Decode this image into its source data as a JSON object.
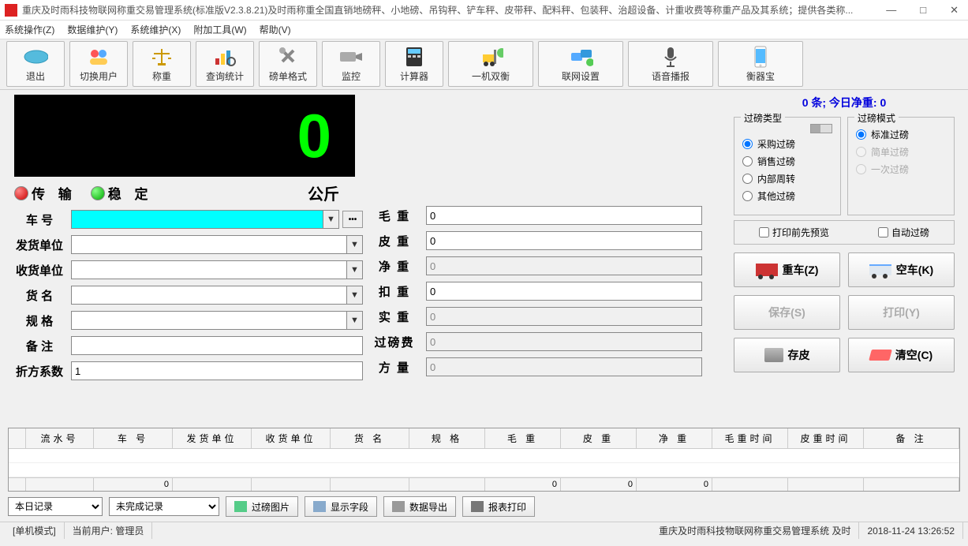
{
  "window": {
    "title": "重庆及时雨科技物联网称重交易管理系统(标准版V2.3.8.21)及时雨称重全国直销地磅秤、小地磅、吊钩秤、铲车秤、皮带秤、配料秤、包装秤、治超设备、计重收费等称重产品及其系统；提供各类称..."
  },
  "menu": {
    "items": [
      "系统操作(Z)",
      "数据维护(Y)",
      "系统维护(X)",
      "附加工具(W)",
      "帮助(V)"
    ]
  },
  "toolbar": [
    {
      "label": "退出"
    },
    {
      "label": "切换用户"
    },
    {
      "label": "称重"
    },
    {
      "label": "查询统计"
    },
    {
      "label": "磅单格式"
    },
    {
      "label": "监控"
    },
    {
      "label": "计算器"
    },
    {
      "label": "一机双衡"
    },
    {
      "label": "联网设置"
    },
    {
      "label": "语音播报"
    },
    {
      "label": "衡器宝"
    }
  ],
  "weight": {
    "value": "0",
    "unit": "公斤",
    "transfer": "传 输",
    "stable": "稳 定"
  },
  "form_left": {
    "vehicle": {
      "label": "车 号",
      "value": ""
    },
    "sender": {
      "label": "发货单位",
      "value": ""
    },
    "receiver": {
      "label": "收货单位",
      "value": ""
    },
    "goods": {
      "label": "货 名",
      "value": ""
    },
    "spec": {
      "label": "规 格",
      "value": ""
    },
    "remark": {
      "label": "备 注",
      "value": ""
    },
    "coef": {
      "label": "折方系数",
      "value": "1"
    }
  },
  "form_mid": {
    "gross": {
      "label": "毛 重",
      "value": "0"
    },
    "tare": {
      "label": "皮 重",
      "value": "0"
    },
    "net": {
      "label": "净 重",
      "value": "0"
    },
    "deduct": {
      "label": "扣 重",
      "value": "0"
    },
    "real": {
      "label": "实 重",
      "value": "0"
    },
    "fee": {
      "label": "过磅费",
      "value": "0"
    },
    "volume": {
      "label": "方 量",
      "value": "0"
    }
  },
  "summary": "0 条;  今日净重:  0",
  "group_type": {
    "title": "过磅类型",
    "options": [
      "采购过磅",
      "销售过磅",
      "内部周转",
      "其他过磅"
    ],
    "selected": "采购过磅"
  },
  "group_mode": {
    "title": "过磅模式",
    "options": [
      "标准过磅",
      "简单过磅",
      "一次过磅"
    ],
    "selected": "标准过磅"
  },
  "checks": {
    "preview": "打印前先预览",
    "auto": "自动过磅"
  },
  "buttons": {
    "heavy": "重车(Z)",
    "empty": "空车(K)",
    "save": "保存(S)",
    "print": "打印(Y)",
    "tare": "存皮",
    "clear": "清空(C)"
  },
  "grid": {
    "headers": [
      "",
      "流水号",
      "车  号",
      "发货单位",
      "收货单位",
      "货  名",
      "规  格",
      "毛  重",
      "皮  重",
      "净  重",
      "毛重时间",
      "皮重时间",
      "备  注"
    ],
    "sums": [
      "",
      "",
      "0",
      "",
      "",
      "",
      "",
      "0",
      "0",
      "0",
      "",
      "",
      ""
    ]
  },
  "bottom": {
    "filter1": "本日记录",
    "filter2": "未完成记录",
    "btn_img": "过磅图片",
    "btn_fields": "显示字段",
    "btn_export": "数据导出",
    "btn_report": "报表打印"
  },
  "status": {
    "mode": "[单机模式]",
    "user": "当前用户: 管理员",
    "system": "重庆及时雨科技物联网称重交易管理系统   及时",
    "datetime": "2018-11-24 13:26:52"
  }
}
